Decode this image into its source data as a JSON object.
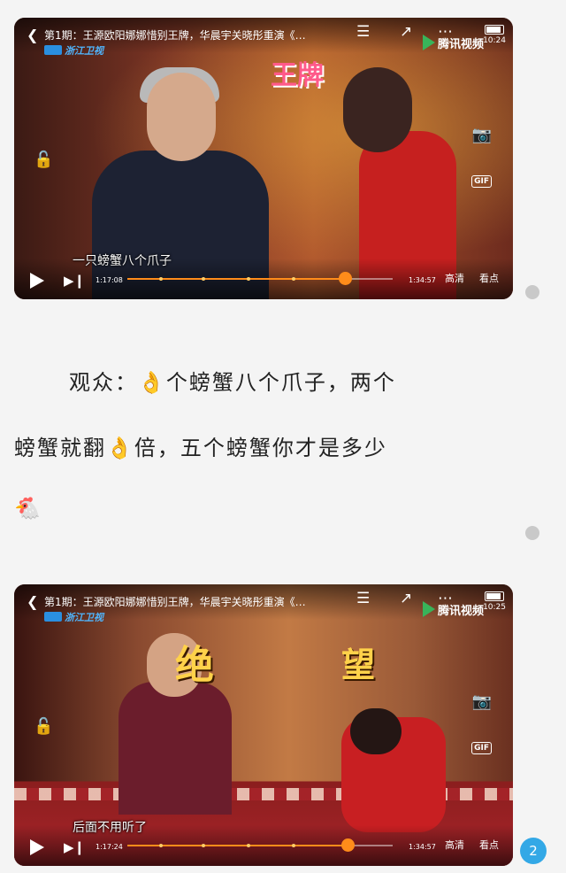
{
  "videos": [
    {
      "title": "第1期：王源欧阳娜娜惜别王牌，华晨宇关晓彤重演《…",
      "channel_logo": "浙江卫视",
      "platform_logo": "腾讯视频",
      "clock": "10:24",
      "subtitle": "一只螃蟹八个爪子",
      "current_time": "1:17:08",
      "total_time": "1:34:57",
      "progress": 0.82,
      "quality_label": "高清",
      "focus_label": "看点",
      "icons": {
        "back": "back-chevron-icon",
        "playlist": "playlist-icon",
        "share": "share-icon",
        "more": "more-icon",
        "lock": "lock-icon",
        "screenshot": "camera-icon",
        "gif": "gif-icon",
        "play": "play-icon",
        "next": "next-icon"
      },
      "gif_label": "GIF"
    },
    {
      "title": "第1期：王源欧阳娜娜惜别王牌，华晨宇关晓彤重演《…",
      "channel_logo": "浙江卫视",
      "platform_logo": "腾讯视频",
      "clock": "10:25",
      "subtitle": "后面不用听了",
      "current_time": "1:17:24",
      "total_time": "1:34:57",
      "progress": 0.83,
      "quality_label": "高清",
      "focus_label": "看点",
      "captions": [
        "绝",
        "望"
      ],
      "gif_label": "GIF"
    }
  ],
  "article": {
    "line1": "观众：👌个螃蟹八个爪子，两个",
    "line2": "螃蟹就翻👌倍，五个螃蟹你才是多少",
    "line3": "🐔"
  },
  "page_badge": "2",
  "colors": {
    "progress_fill": "#ff8c1a",
    "badge": "#33a8e6",
    "background": "#f4f4f4"
  }
}
